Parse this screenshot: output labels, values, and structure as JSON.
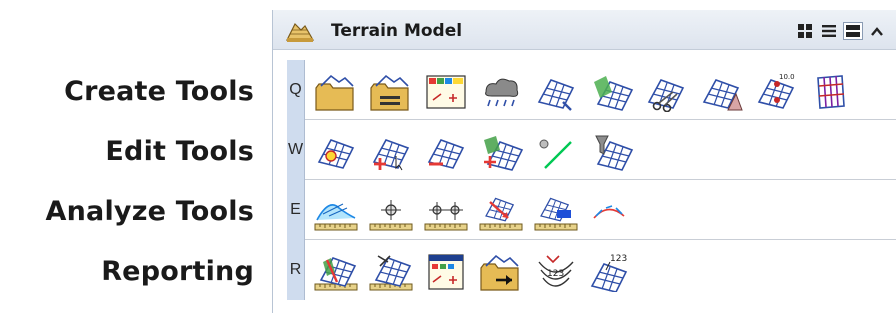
{
  "labels": [
    {
      "text": "Create Tools",
      "name": "label-create-tools"
    },
    {
      "text": "Edit Tools",
      "name": "label-edit-tools"
    },
    {
      "text": "Analyze Tools",
      "name": "label-analyze-tools"
    },
    {
      "text": "Reporting",
      "name": "label-reporting"
    }
  ],
  "panel": {
    "title": "Terrain Model",
    "title_icon": "terrain-model-icon",
    "view_buttons": [
      "grid-view-icon",
      "list-view-icon",
      "large-icons-view-icon",
      "collapse-icon"
    ]
  },
  "rows": [
    {
      "key": "Q",
      "name": "row-create",
      "tools": [
        "terrain-from-file-icon",
        "terrain-from-elements-icon",
        "terrain-from-graphic-filter-icon",
        "terrain-from-point-cloud-icon",
        "clip-terrain-icon",
        "complex-terrain-icon",
        "terrain-by-scissors-icon",
        "terrain-from-triangle-icon",
        "terrain-from-text-icon",
        "terrain-from-surfaces-icon"
      ]
    },
    {
      "key": "W",
      "name": "row-edit",
      "tools": [
        "terrain-edit-icon",
        "add-terrain-point-icon",
        "delete-terrain-element-icon",
        "add-remove-feature-icon",
        "drape-line-icon",
        "terrain-filter-icon"
      ]
    },
    {
      "key": "E",
      "name": "row-analyze",
      "tools": [
        "analyze-elevation-icon",
        "analyze-point-icon",
        "analyze-between-points-icon",
        "analyze-drainage-icon",
        "analyze-volume-icon",
        "analyze-profile-icon"
      ]
    },
    {
      "key": "R",
      "name": "row-reporting",
      "tools": [
        "terrain-report-icon",
        "crossing-features-report-icon",
        "report-filter-icon",
        "export-terrain-icon",
        "contour-labels-icon",
        "label-spots-icon"
      ]
    }
  ],
  "colors": {
    "panel_accent": "#cfdcee",
    "title_background": "#dde4ee",
    "mesh_blue": "#2f4fa8"
  }
}
